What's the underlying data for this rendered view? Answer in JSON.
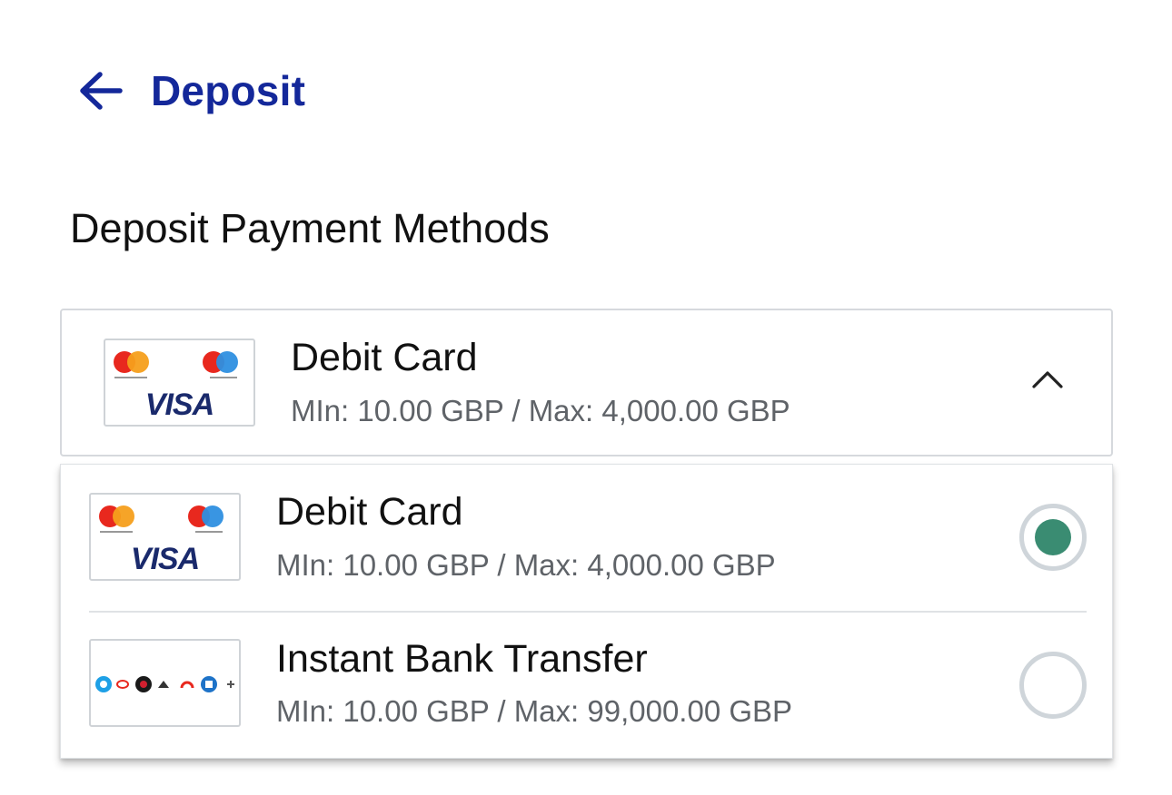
{
  "header": {
    "title": "Deposit",
    "back_icon": "arrow-left-icon",
    "color": "#14289a"
  },
  "section_title": "Deposit Payment Methods",
  "selected": {
    "name": "Debit Card",
    "limits": "MIn: 10.00 GBP / Max: 4,000.00 GBP",
    "logo_text": "VISA",
    "toggle_icon": "chevron-up-icon"
  },
  "options": [
    {
      "name": "Debit Card",
      "limits": "MIn: 10.00 GBP / Max: 4,000.00 GBP",
      "logo_text": "VISA",
      "selected": true
    },
    {
      "name": "Instant Bank Transfer",
      "limits": "MIn: 10.00 GBP / Max: 99,000.00 GBP",
      "selected": false
    }
  ],
  "colors": {
    "radio_selected": "#3a8c72",
    "radio_border": "#cfd5da",
    "visa": "#1a2a6c"
  }
}
